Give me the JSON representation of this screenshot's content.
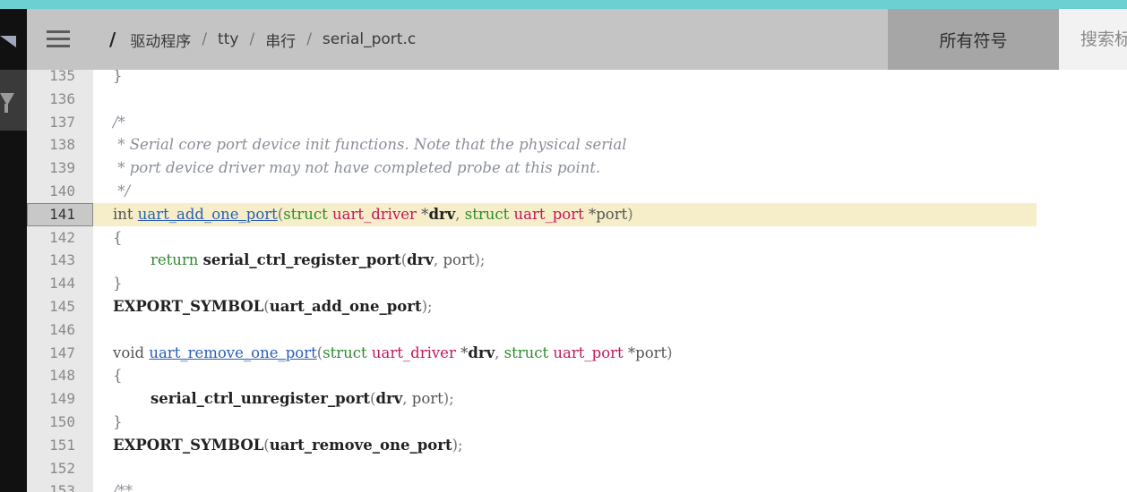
{
  "header": {
    "breadcrumb_root": "/",
    "breadcrumb": [
      "驱动程序",
      "tty",
      "串行",
      "serial_port.c"
    ],
    "symbols_tab": "所有符号",
    "search_placeholder": "搜索标识符"
  },
  "code": {
    "highlighted_line": 141,
    "lines": [
      {
        "n": "135",
        "parts": [
          [
            "punct",
            "}"
          ]
        ]
      },
      {
        "n": "136",
        "parts": []
      },
      {
        "n": "137",
        "parts": [
          [
            "comment",
            "/*"
          ]
        ]
      },
      {
        "n": "138",
        "parts": [
          [
            "comment",
            " * Serial core port device init functions. Note that the physical serial"
          ]
        ]
      },
      {
        "n": "139",
        "parts": [
          [
            "comment",
            " * port device driver may not have completed probe at this point."
          ]
        ]
      },
      {
        "n": "140",
        "parts": [
          [
            "comment",
            " */"
          ]
        ]
      },
      {
        "n": "141",
        "parts": [
          [
            "kw-int",
            "int "
          ],
          [
            "fn",
            "uart_add_one_port"
          ],
          [
            "punct",
            "("
          ],
          [
            "kw-type",
            "struct "
          ],
          [
            "ty",
            "uart_driver"
          ],
          [
            "plain",
            " *"
          ],
          [
            "bold",
            "drv"
          ],
          [
            "punct",
            ", "
          ],
          [
            "kw-type",
            "struct "
          ],
          [
            "ty",
            "uart_port"
          ],
          [
            "plain",
            " *port"
          ],
          [
            "punct",
            ")"
          ]
        ]
      },
      {
        "n": "142",
        "parts": [
          [
            "punct",
            "{"
          ]
        ]
      },
      {
        "n": "143",
        "parts": [
          [
            "plain",
            "        "
          ],
          [
            "kw-ret",
            "return "
          ],
          [
            "bold",
            "serial_ctrl_register_port"
          ],
          [
            "punct",
            "("
          ],
          [
            "bold",
            "drv"
          ],
          [
            "punct",
            ", "
          ],
          [
            "plain",
            "port"
          ],
          [
            "punct",
            ");"
          ]
        ]
      },
      {
        "n": "144",
        "parts": [
          [
            "punct",
            "}"
          ]
        ]
      },
      {
        "n": "145",
        "parts": [
          [
            "bold",
            "EXPORT_SYMBOL"
          ],
          [
            "punct",
            "("
          ],
          [
            "bold",
            "uart_add_one_port"
          ],
          [
            "punct",
            ");"
          ]
        ]
      },
      {
        "n": "146",
        "parts": []
      },
      {
        "n": "147",
        "parts": [
          [
            "kw-int",
            "void "
          ],
          [
            "fn",
            "uart_remove_one_port"
          ],
          [
            "punct",
            "("
          ],
          [
            "kw-type",
            "struct "
          ],
          [
            "ty",
            "uart_driver"
          ],
          [
            "plain",
            " *"
          ],
          [
            "bold",
            "drv"
          ],
          [
            "punct",
            ", "
          ],
          [
            "kw-type",
            "struct "
          ],
          [
            "ty",
            "uart_port"
          ],
          [
            "plain",
            " *port"
          ],
          [
            "punct",
            ")"
          ]
        ]
      },
      {
        "n": "148",
        "parts": [
          [
            "punct",
            "{"
          ]
        ]
      },
      {
        "n": "149",
        "parts": [
          [
            "plain",
            "        "
          ],
          [
            "bold",
            "serial_ctrl_unregister_port"
          ],
          [
            "punct",
            "("
          ],
          [
            "bold",
            "drv"
          ],
          [
            "punct",
            ", "
          ],
          [
            "plain",
            "port"
          ],
          [
            "punct",
            ");"
          ]
        ]
      },
      {
        "n": "150",
        "parts": [
          [
            "punct",
            "}"
          ]
        ]
      },
      {
        "n": "151",
        "parts": [
          [
            "bold",
            "EXPORT_SYMBOL"
          ],
          [
            "punct",
            "("
          ],
          [
            "bold",
            "uart_remove_one_port"
          ],
          [
            "punct",
            ");"
          ]
        ]
      },
      {
        "n": "152",
        "parts": []
      },
      {
        "n": "153",
        "parts": [
          [
            "comment",
            "/**"
          ]
        ]
      }
    ]
  },
  "icons": {
    "menu": "hamburger-menu-icon",
    "left_rail_top": "triangle-icon",
    "left_rail_filter": "filter-icon"
  },
  "colors": {
    "top_strip": "#6dcfcf",
    "header_bg": "#c4c4c4",
    "symbols_tab_bg": "#a6a6a6",
    "highlight_line_bg": "#f5eec8",
    "function_link": "#2b5fb4",
    "type_name": "#c2185b",
    "keyword": "#2e8b2e",
    "comment": "#8a8f99"
  }
}
